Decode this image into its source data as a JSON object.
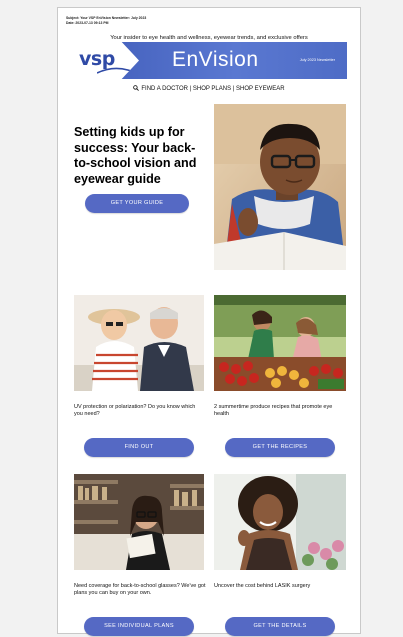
{
  "meta": {
    "subject": "Subject: Your VSP EnVision Newsletter: July 2023",
    "date": "Date: 2023-07-13 09:13 PM"
  },
  "tagline": "Your insider to eye health and wellness, eyewear trends, and exclusive offers",
  "banner": {
    "logo": "vsp",
    "brand": "EnVision",
    "issue": "July 2023 Newsletter",
    "color": "#4a66c4"
  },
  "nav": {
    "find_doctor": "FIND A DOCTOR",
    "separator1": "|",
    "shop_plans": "SHOP PLANS",
    "separator2": "|",
    "shop_eyewear": "SHOP EYEWEAR",
    "icon": "search-icon"
  },
  "hero": {
    "title": "Setting kids up for success: Your back-to-school vision and eyewear guide",
    "button": "GET YOUR GUIDE",
    "image": "boy-with-glasses-reading-photo"
  },
  "articles": [
    {
      "caption": "UV protection or polarization? Do you know which you need?",
      "button": "FIND OUT",
      "image": "older-couple-sunglasses-photo"
    },
    {
      "caption": "2 summertime produce recipes that promote eye health",
      "button": "GET THE RECIPES",
      "image": "farmers-market-produce-photo"
    },
    {
      "caption": "Need coverage for back-to-school glasses? We've got plans you can buy on your own.",
      "button": "SEE INDIVIDUAL PLANS",
      "image": "student-reading-library-photo"
    },
    {
      "caption": "Uncover the cost behind LASIK surgery",
      "button": "GET THE DETAILS",
      "image": "smiling-woman-outdoors-photo"
    }
  ],
  "colors": {
    "button": "#5569c4",
    "banner": "#4a66c4"
  }
}
